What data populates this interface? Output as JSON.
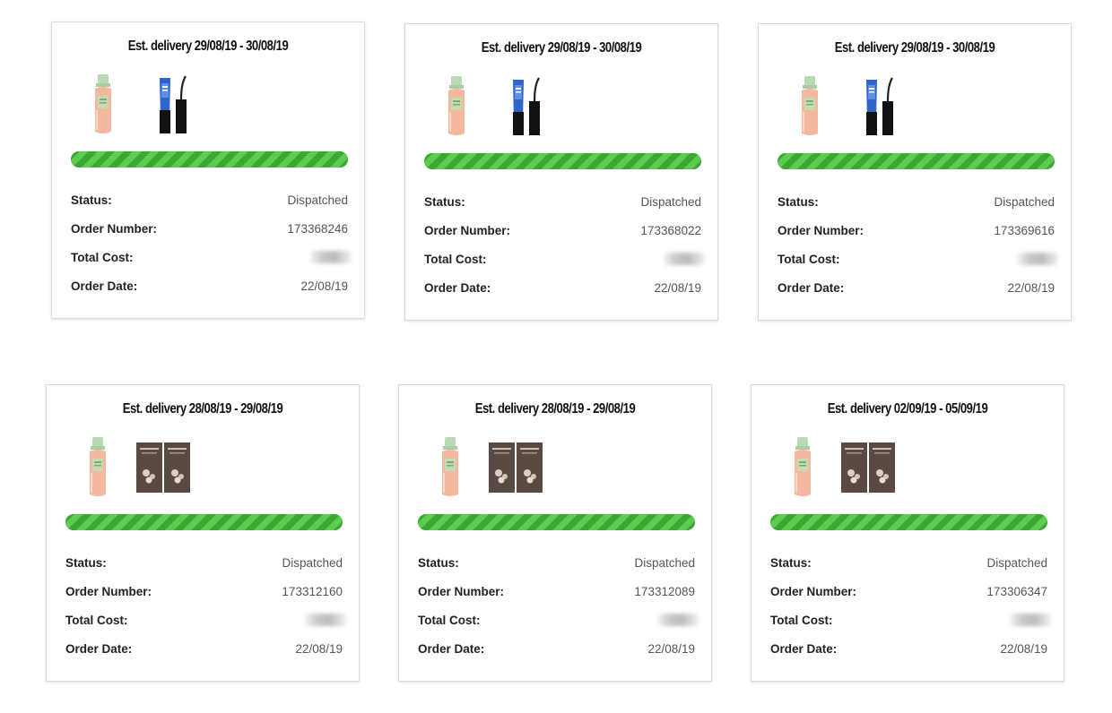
{
  "labels": {
    "status": "Status:",
    "order_number": "Order Number:",
    "total_cost": "Total Cost:",
    "order_date": "Order Date:"
  },
  "colors": {
    "progress_green": "#43b53b",
    "border": "#d9d9d9"
  },
  "orders": [
    {
      "delivery": "Est. delivery 29/08/19 - 30/08/19",
      "products": [
        "toner-bottle",
        "mascara"
      ],
      "progress": 1.0,
      "status": "Dispatched",
      "order_number": "173368246",
      "total_cost": "",
      "order_date": "22/08/19"
    },
    {
      "delivery": "Est. delivery 29/08/19 - 30/08/19",
      "products": [
        "toner-bottle",
        "mascara"
      ],
      "progress": 1.0,
      "status": "Dispatched",
      "order_number": "173368022",
      "total_cost": "",
      "order_date": "22/08/19"
    },
    {
      "delivery": "Est. delivery 29/08/19 - 30/08/19",
      "products": [
        "toner-bottle",
        "mascara"
      ],
      "progress": 1.0,
      "status": "Dispatched",
      "order_number": "173369616",
      "total_cost": "",
      "order_date": "22/08/19"
    },
    {
      "delivery": "Est. delivery 28/08/19 - 29/08/19",
      "products": [
        "toner-bottle",
        "sachets"
      ],
      "progress": 1.0,
      "status": "Dispatched",
      "order_number": "173312160",
      "total_cost": "",
      "order_date": "22/08/19"
    },
    {
      "delivery": "Est. delivery 28/08/19 - 29/08/19",
      "products": [
        "toner-bottle",
        "sachets"
      ],
      "progress": 1.0,
      "status": "Dispatched",
      "order_number": "173312089",
      "total_cost": "",
      "order_date": "22/08/19"
    },
    {
      "delivery": "Est. delivery 02/09/19 - 05/09/19",
      "products": [
        "toner-bottle",
        "sachets"
      ],
      "progress": 1.0,
      "status": "Dispatched",
      "order_number": "173306347",
      "total_cost": "",
      "order_date": "22/08/19"
    }
  ]
}
